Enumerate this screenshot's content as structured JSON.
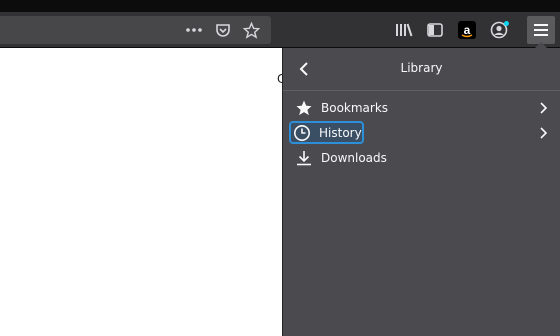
{
  "toolbar": {
    "icons": [
      "more-icon",
      "pocket-icon",
      "star-icon",
      "library-icon",
      "sidebar-icon",
      "amazon-icon",
      "account-icon",
      "menu-icon"
    ]
  },
  "content": {
    "edge_char": "C"
  },
  "panel": {
    "title": "Library",
    "items": [
      {
        "label": "Bookmarks",
        "icon": "star-icon",
        "has_submenu": true
      },
      {
        "label": "History",
        "icon": "clock-icon",
        "has_submenu": true,
        "highlighted": true
      },
      {
        "label": "Downloads",
        "icon": "download-icon",
        "has_submenu": false
      }
    ]
  },
  "colors": {
    "toolbar": "#323234",
    "panel": "#4a4a4f",
    "highlight_border": "#2d8fd8",
    "notification_dot": "#0fd5f2"
  }
}
